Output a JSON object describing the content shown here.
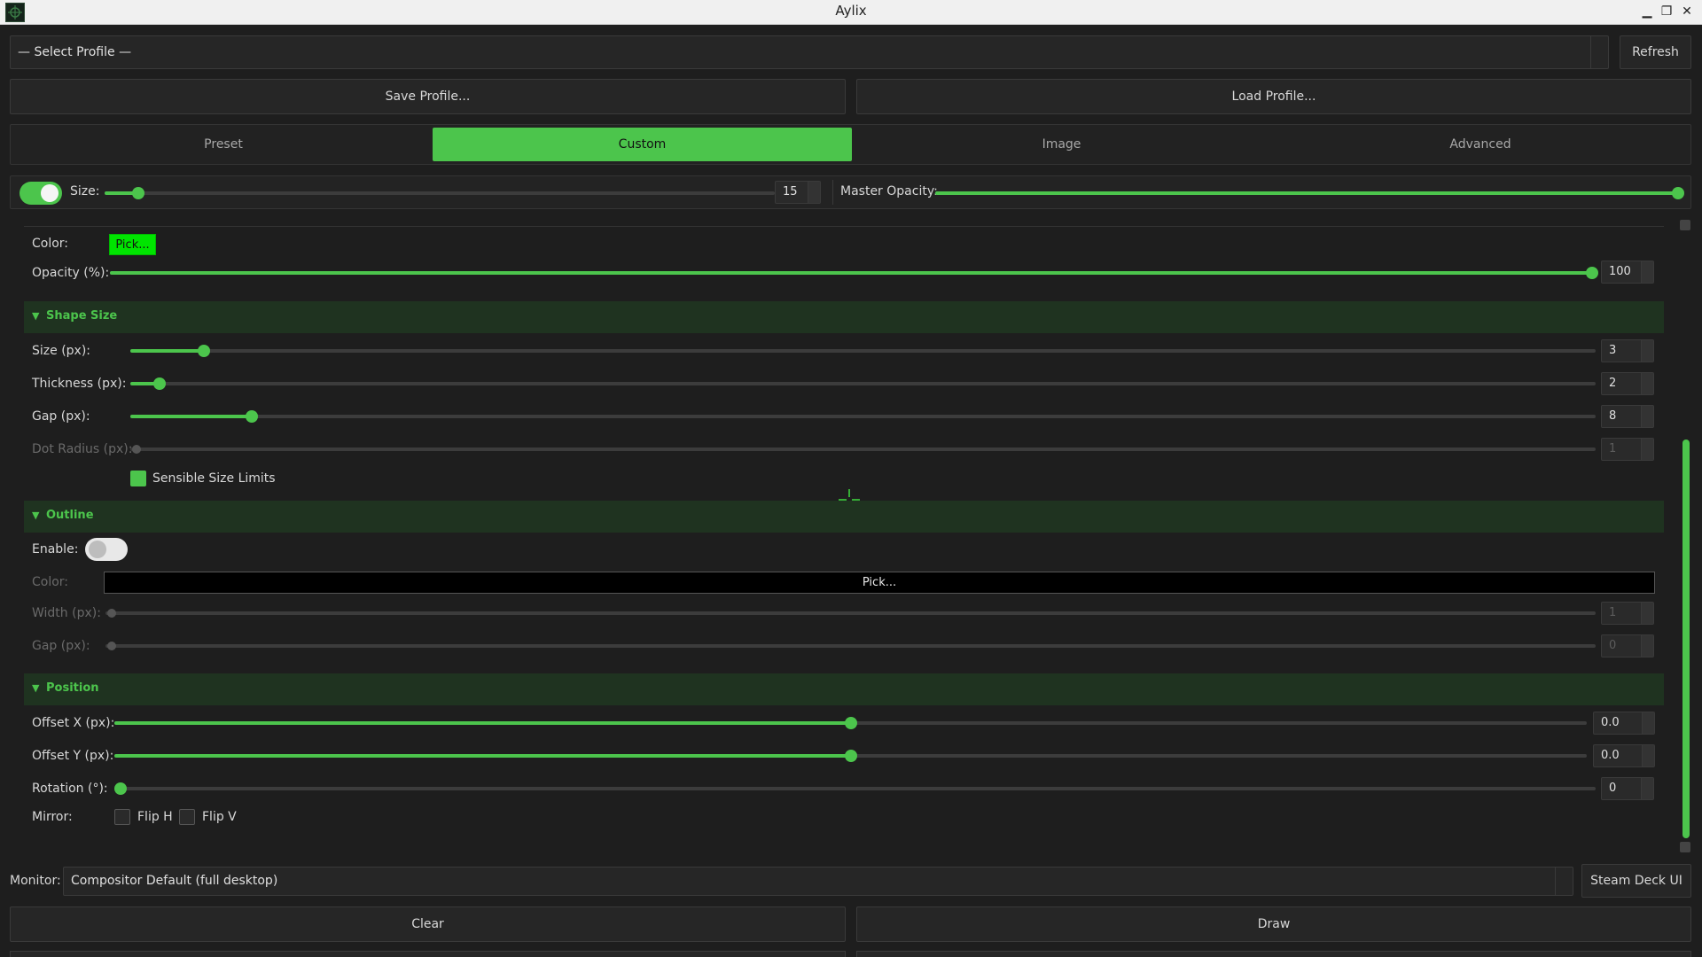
{
  "window": {
    "title": "Aylix"
  },
  "profile": {
    "selected": "— Select Profile —",
    "refresh": "Refresh",
    "save": "Save Profile...",
    "load": "Load Profile..."
  },
  "tabs": [
    {
      "label": "Preset",
      "active": false
    },
    {
      "label": "Custom",
      "active": true
    },
    {
      "label": "Image",
      "active": false
    },
    {
      "label": "Advanced",
      "active": false
    }
  ],
  "topbar": {
    "size_label": "Size:",
    "size_value": "15",
    "master_opacity_label": "Master Opacity:",
    "enabled": true,
    "master_opacity_fraction": 1.0,
    "size_fraction": 0.05
  },
  "main": {
    "color_label": "Color:",
    "pick": "Pick...",
    "opacity_label": "Opacity (%):",
    "opacity_value": "100"
  },
  "shape_size": {
    "header": "Shape Size",
    "size_label": "Size (px):",
    "size_value": "3",
    "thickness_label": "Thickness (px):",
    "thickness_value": "2",
    "gap_label": "Gap (px):",
    "gap_value": "8",
    "dot_label": "Dot Radius (px):",
    "dot_value": "1",
    "sensible_label": "Sensible Size Limits"
  },
  "outline": {
    "header": "Outline",
    "enable_label": "Enable:",
    "color_label": "Color:",
    "pick": "Pick...",
    "width_label": "Width (px):",
    "width_value": "1",
    "gap_label": "Gap (px):",
    "gap_value": "0"
  },
  "position": {
    "header": "Position",
    "offset_x_label": "Offset X (px):",
    "offset_x_value": "0.0",
    "offset_y_label": "Offset Y (px):",
    "offset_y_value": "0.0",
    "rotation_label": "Rotation (°):",
    "rotation_value": "0",
    "mirror_label": "Mirror:",
    "flip_h": "Flip H",
    "flip_v": "Flip V"
  },
  "monitor": {
    "label": "Monitor:",
    "value": "Compositor Default (full desktop)",
    "steam_deck": "Steam Deck UI"
  },
  "bottom": {
    "clear": "Clear",
    "draw": "Draw"
  },
  "colors": {
    "accent": "#4cc54c",
    "pick_fill": "#00e400",
    "background": "#1e1e1e"
  }
}
